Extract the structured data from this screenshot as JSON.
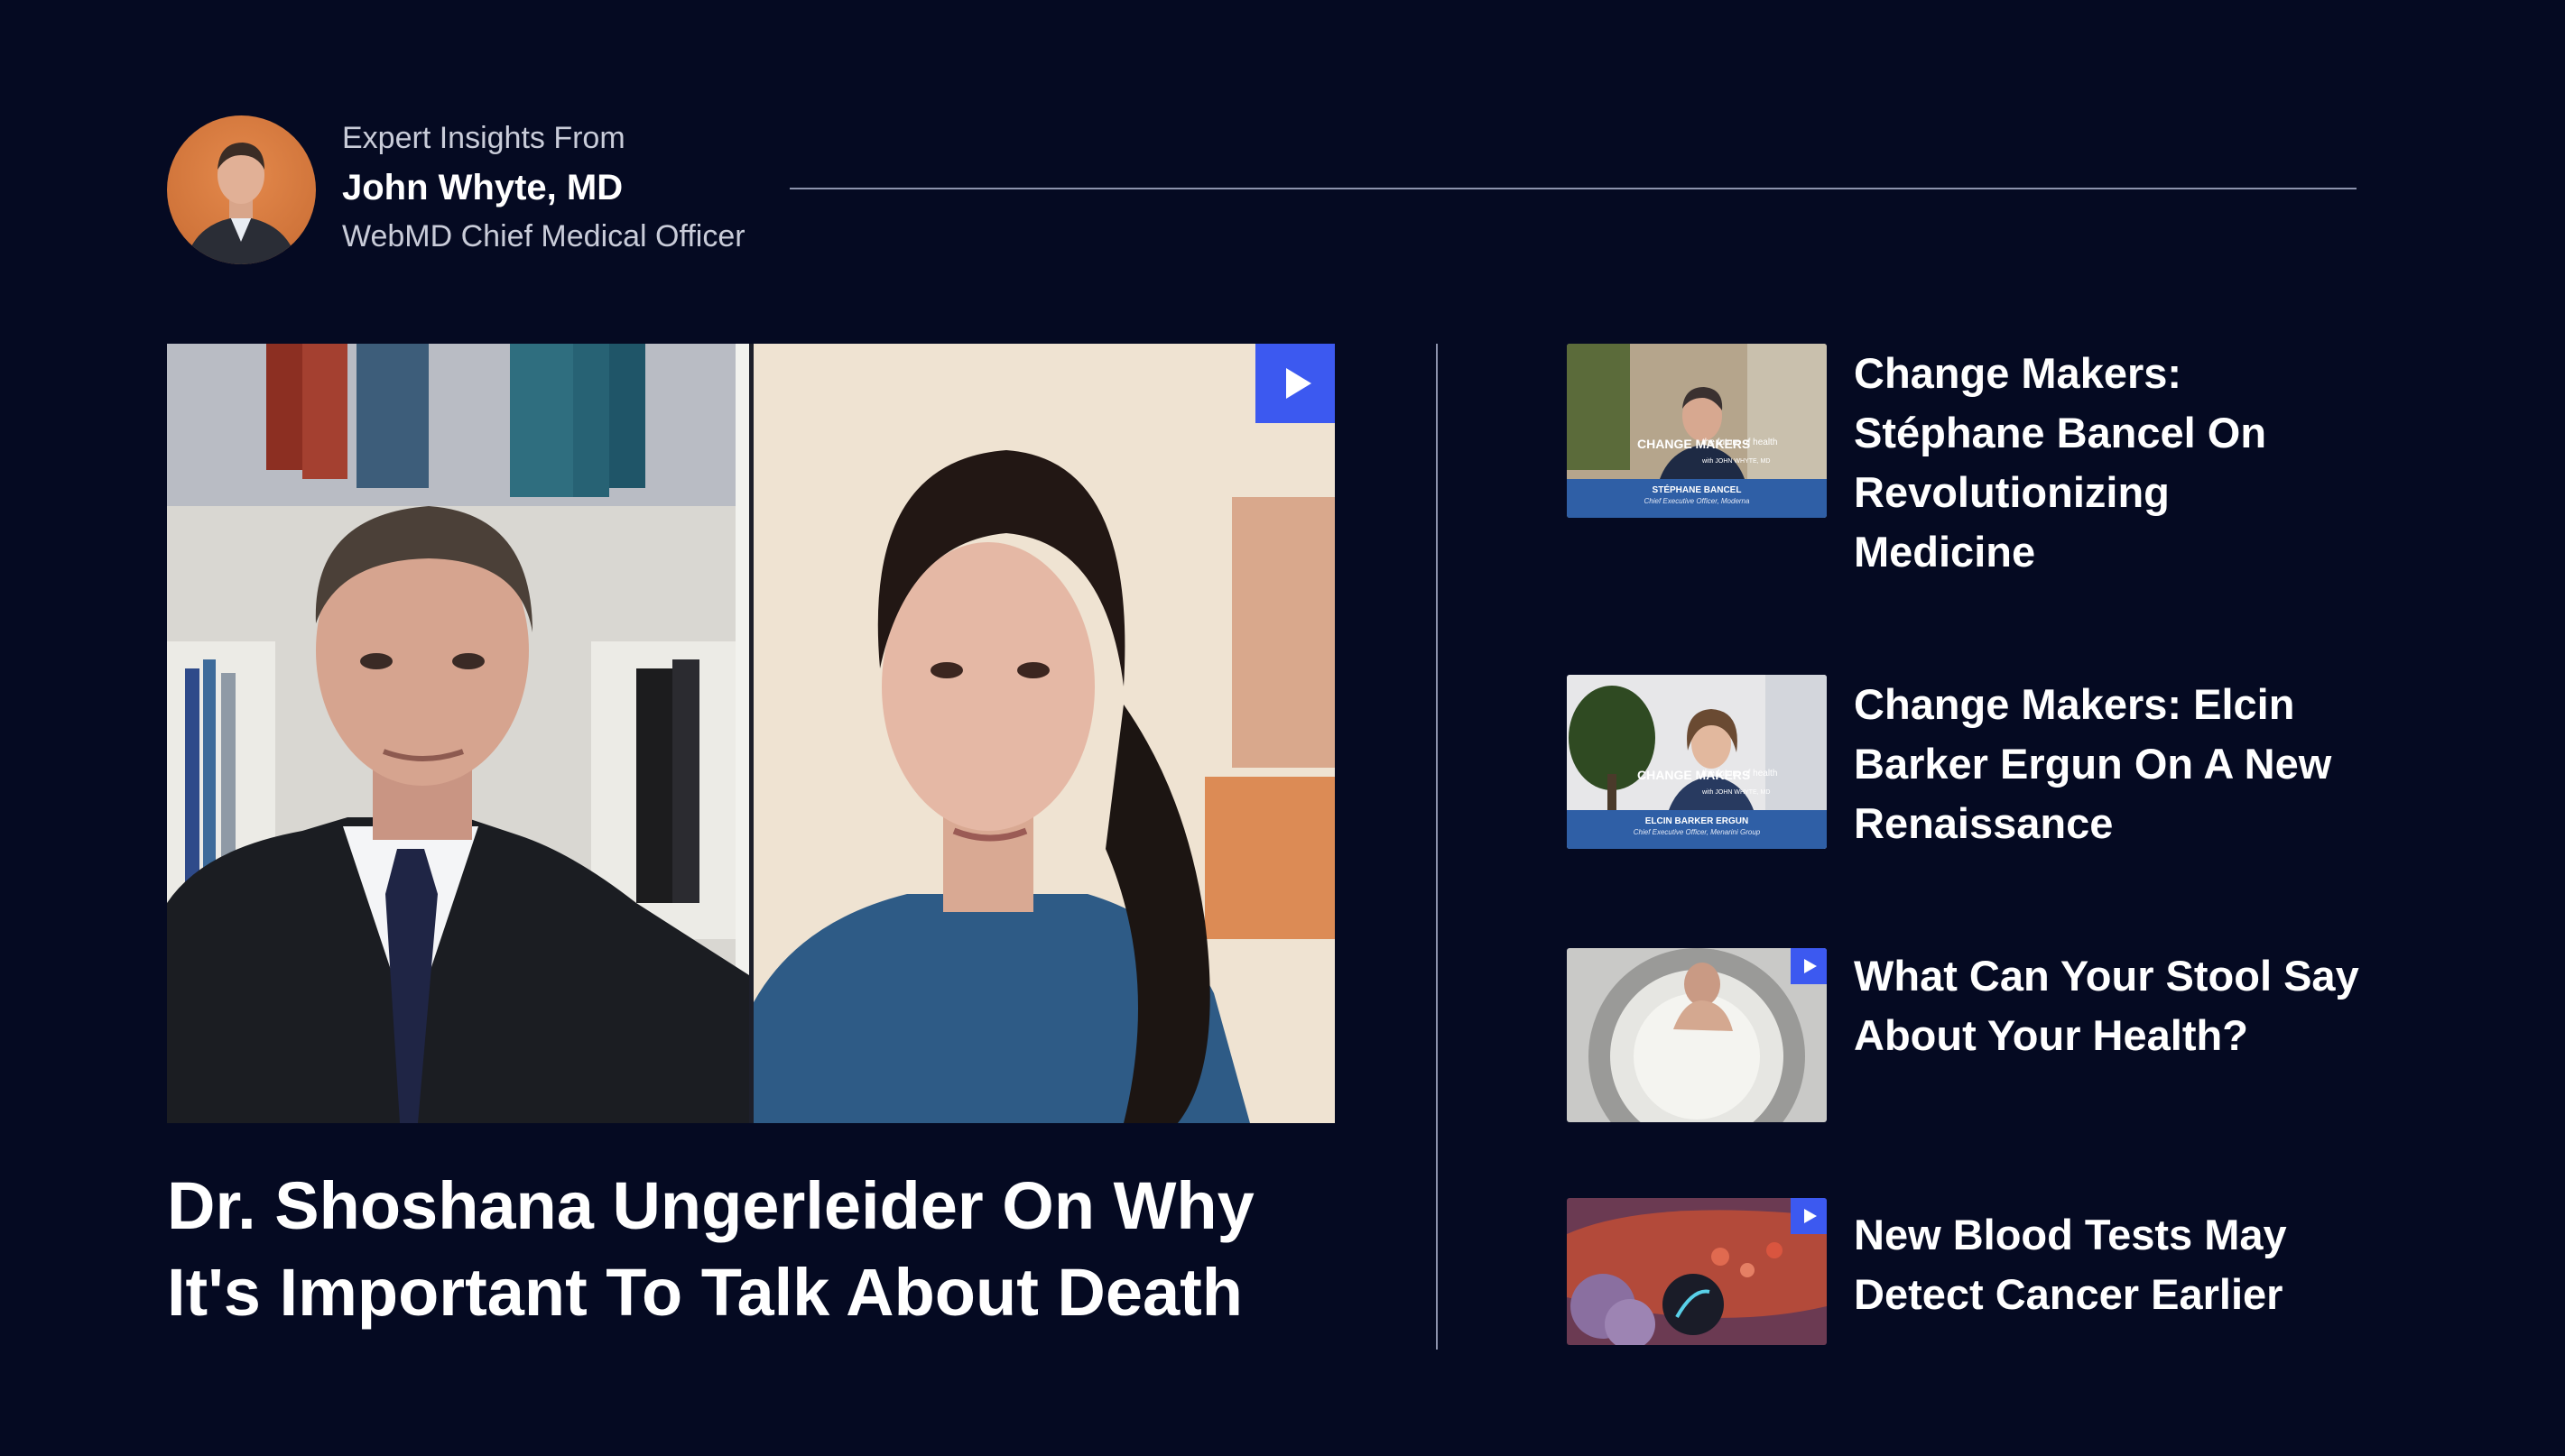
{
  "expert": {
    "pre_label": "Expert Insights From",
    "name": "John Whyte, MD",
    "role": "WebMD Chief Medical Officer"
  },
  "feature": {
    "title": "Dr. Shoshana Ungerleider On Why It's Important To Talk About Death",
    "play_icon": "play-icon"
  },
  "related": [
    {
      "title": "Change Makers: Stéphane Bancel On Revolutionizing Medicine",
      "thumb_caption": "STÉPHANE BANCEL",
      "thumb_subcaption": "Chief Executive Officer, Moderna",
      "badge": "CHANGE MAKERS",
      "badge_sub": "the future of health",
      "badge_host": "with JOHN WHYTE, MD"
    },
    {
      "title": "Change Makers: Elcin Barker Ergun On A New Renaissance",
      "thumb_caption": "ELCIN BARKER ERGUN",
      "thumb_subcaption": "Chief Executive Officer, Menarini Group",
      "badge": "CHANGE MAKERS",
      "badge_sub": "the future of health",
      "badge_host": "with JOHN WHYTE, MD"
    },
    {
      "title": "What Can Your Stool Say About Your Health?"
    },
    {
      "title": "New Blood Tests May Detect Cancer Earlier"
    }
  ],
  "colors": {
    "background": "#050a22",
    "accent": "#3c59f0",
    "rule": "#8d93ad"
  }
}
